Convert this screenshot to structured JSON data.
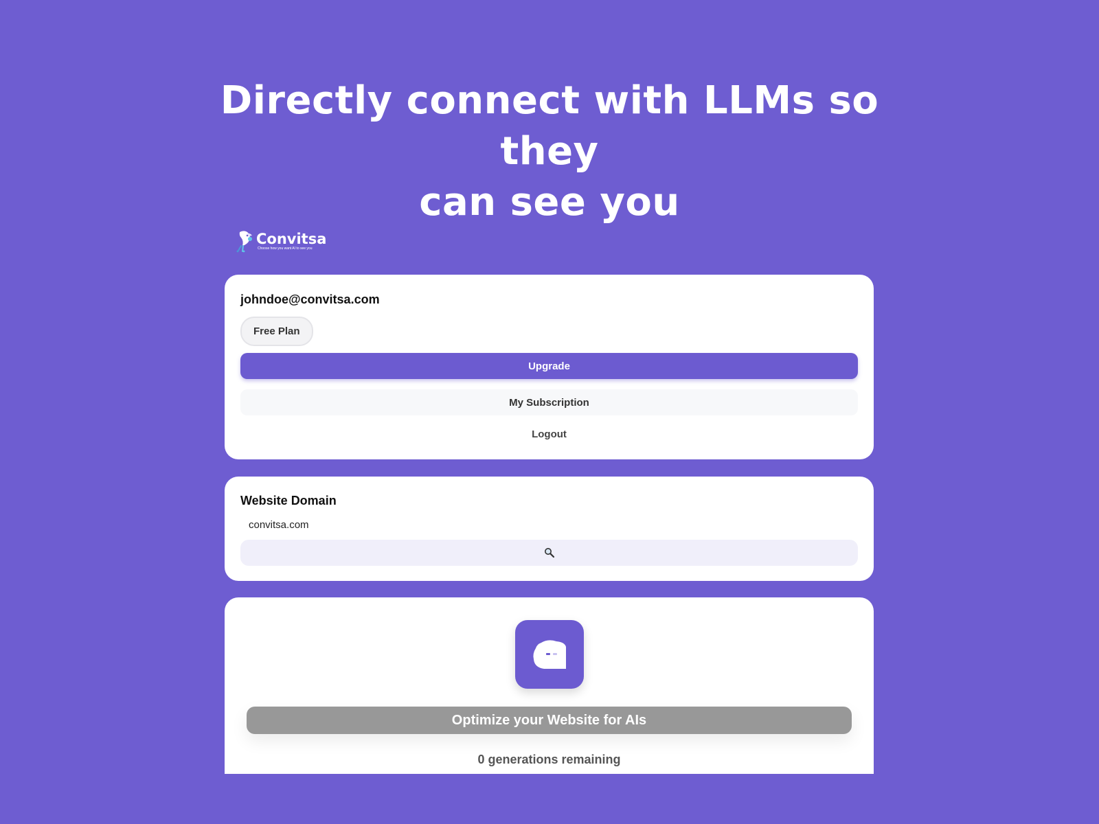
{
  "hero": {
    "title_line1": "Directly connect with LLMs so they",
    "title_line2": "can see you"
  },
  "brand": {
    "name": "Convitsa",
    "tagline": "Choose how you want AI to see you",
    "logo_icon": "parrot-logo-icon"
  },
  "account": {
    "email": "johndoe@convitsa.com",
    "plan_badge": "Free Plan",
    "upgrade_label": "Upgrade",
    "subscription_label": "My Subscription",
    "logout_label": "Logout"
  },
  "domain": {
    "label": "Website Domain",
    "value": "convitsa.com",
    "search_icon": "magnifier-icon"
  },
  "optimize": {
    "app_icon": "chat-bubble-icon",
    "button_label": "Optimize your Website for AIs",
    "remaining_text": "0 generations remaining"
  },
  "colors": {
    "background": "#6e5dd1",
    "accent": "#6c5bd0",
    "card": "#ffffff",
    "disabled_button": "#989898"
  }
}
